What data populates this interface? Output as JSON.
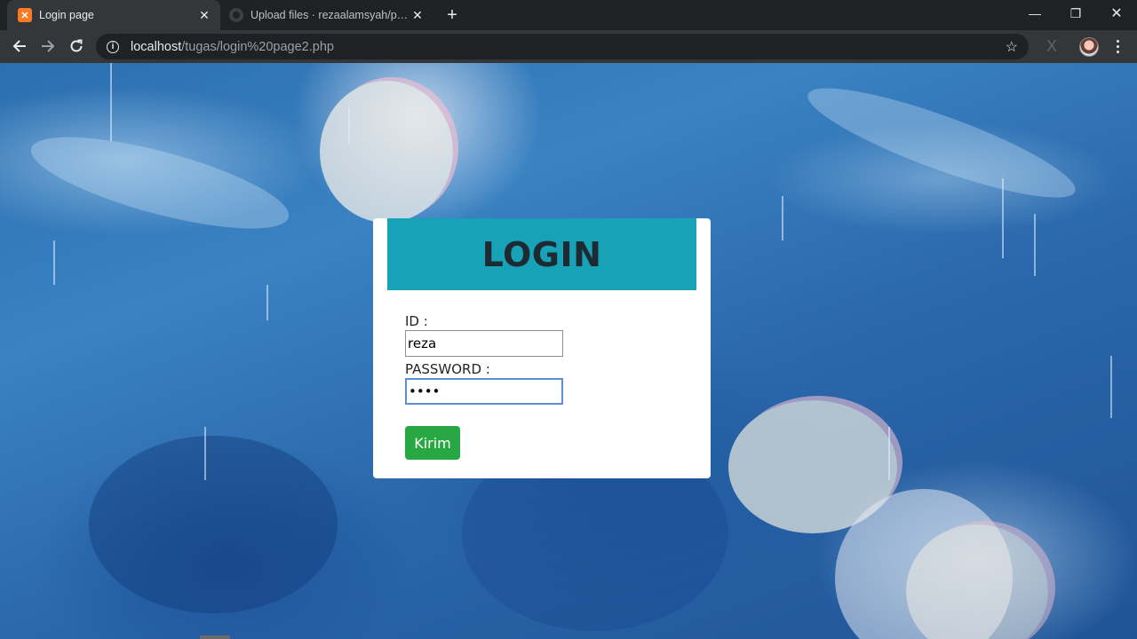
{
  "browser": {
    "tabs": [
      {
        "title": "Login page",
        "icon": "xampp-icon",
        "active": true
      },
      {
        "title": "Upload files · rezaalamsyah/php2",
        "icon": "github-icon",
        "active": false
      }
    ],
    "url_host": "localhost",
    "url_path": "/tugas/login%20page2.php"
  },
  "login": {
    "heading": "LOGIN",
    "id_label": "ID :",
    "id_value": "reza",
    "password_label": "PASSWORD :",
    "password_value": "abcd",
    "submit_label": "Kirim"
  },
  "colors": {
    "header_bg": "#17a2b8",
    "button_bg": "#28a745",
    "page_bg": "#2f75b5"
  }
}
